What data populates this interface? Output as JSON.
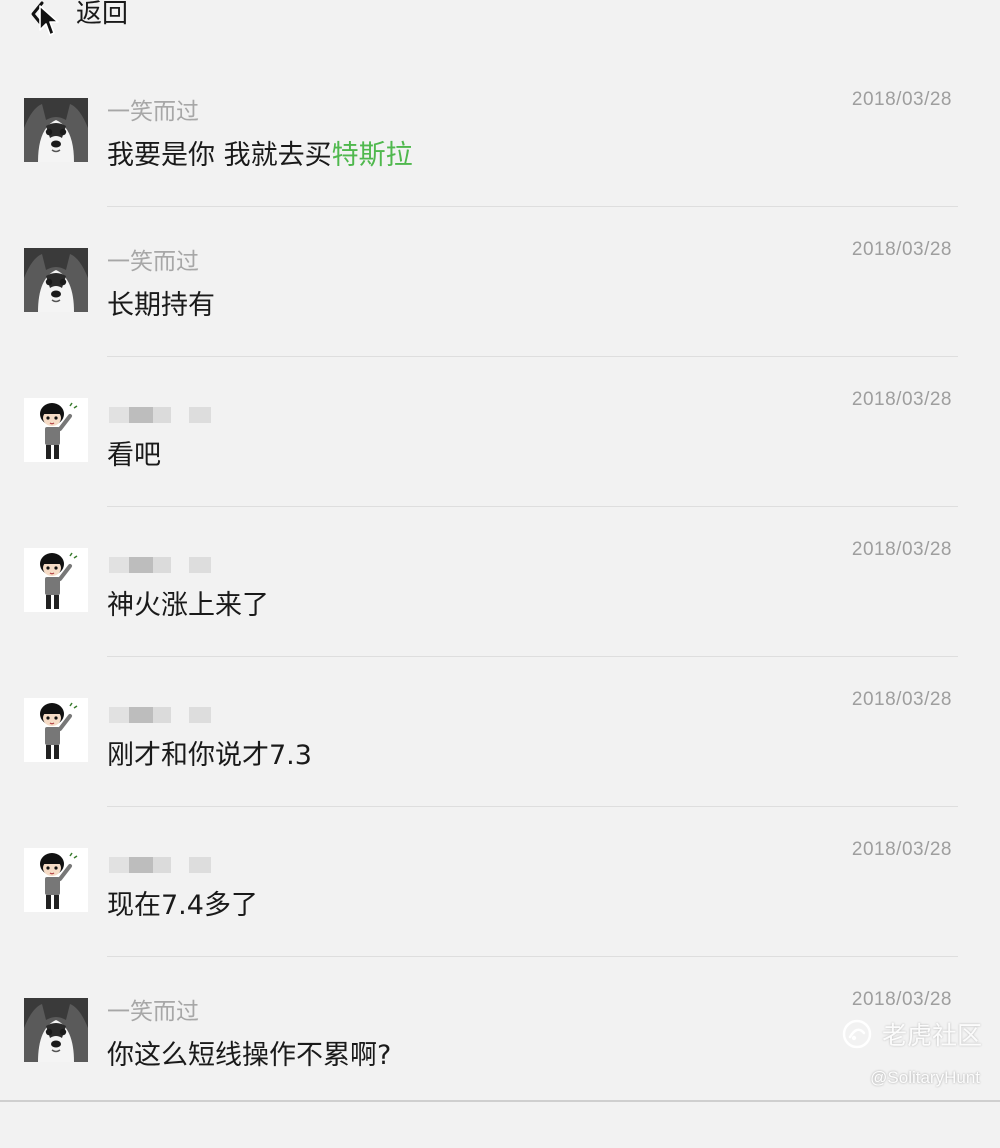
{
  "header": {
    "back_label": "返回"
  },
  "messages": [
    {
      "avatar": "husky-avatar",
      "sender": "一笑而过",
      "sender_blurred": false,
      "time": "2018/03/28",
      "text_before": "我要是你 我就去买",
      "text_link": "特斯拉"
    },
    {
      "avatar": "husky-avatar",
      "sender": "一笑而过",
      "sender_blurred": false,
      "time": "2018/03/28",
      "text_before": "长期持有",
      "text_link": ""
    },
    {
      "avatar": "cartoon-boy-avatar",
      "sender": "",
      "sender_blurred": true,
      "time": "2018/03/28",
      "text_before": "看吧",
      "text_link": ""
    },
    {
      "avatar": "cartoon-boy-avatar",
      "sender": "",
      "sender_blurred": true,
      "time": "2018/03/28",
      "text_before": "神火涨上来了",
      "text_link": ""
    },
    {
      "avatar": "cartoon-boy-avatar",
      "sender": "",
      "sender_blurred": true,
      "time": "2018/03/28",
      "text_before": "刚才和你说才7.3",
      "text_link": ""
    },
    {
      "avatar": "cartoon-boy-avatar",
      "sender": "",
      "sender_blurred": true,
      "time": "2018/03/28",
      "text_before": "现在7.4多了",
      "text_link": ""
    },
    {
      "avatar": "husky-avatar",
      "sender": "一笑而过",
      "sender_blurred": false,
      "time": "2018/03/28",
      "text_before": "你这么短线操作不累啊?",
      "text_link": ""
    }
  ],
  "watermark": {
    "brand": "老虎社区",
    "handle": "@SolitaryHunt"
  },
  "colors": {
    "background": "#f2f2f2",
    "link": "#4fb84d",
    "meta": "#9e9e9e",
    "text": "#1a1a1a",
    "divider": "#dedede"
  }
}
